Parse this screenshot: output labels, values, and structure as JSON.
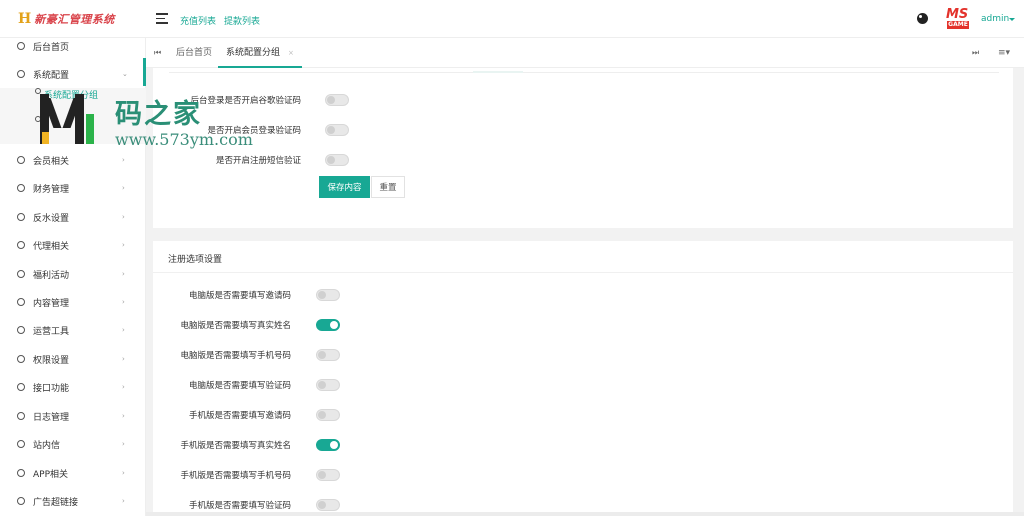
{
  "app": {
    "logo_mark": "H",
    "logo_title": "新豪汇管理系统"
  },
  "header": {
    "links": [
      "充值列表",
      "提款列表"
    ],
    "avatar_text": "MS",
    "avatar_sub": "GAME",
    "user": "admin"
  },
  "sidebar": {
    "items": [
      {
        "label": "后台首页"
      },
      {
        "label": "系统配置"
      },
      {
        "label": "会员相关"
      },
      {
        "label": "财务管理"
      },
      {
        "label": "反水设置"
      },
      {
        "label": "代理相关"
      },
      {
        "label": "福利活动"
      },
      {
        "label": "内容管理"
      },
      {
        "label": "运营工具"
      },
      {
        "label": "权限设置"
      },
      {
        "label": "接口功能"
      },
      {
        "label": "日志管理"
      },
      {
        "label": "站内信"
      },
      {
        "label": "APP相关"
      },
      {
        "label": "广告超链接"
      }
    ],
    "sub_items": [
      "系统配置分组"
    ]
  },
  "tabs": {
    "items": [
      "后台首页",
      "系统配置分组"
    ],
    "close_glyph": "×"
  },
  "panel1": {
    "rows": [
      {
        "label": "后台登录是否开启谷歌验证码",
        "on": false
      },
      {
        "label": "是否开启会员登录验证码",
        "on": false
      },
      {
        "label": "是否开启注册短信验证",
        "on": false
      }
    ],
    "save_label": "保存内容",
    "reset_label": "重置"
  },
  "panel2": {
    "title": "注册选项设置",
    "rows": [
      {
        "label": "电脑版是否需要填写邀请码",
        "on": false
      },
      {
        "label": "电脑版是否需要填写真实姓名",
        "on": true
      },
      {
        "label": "电脑版是否需要填写手机号码",
        "on": false
      },
      {
        "label": "电脑版是否需要填写验证码",
        "on": false
      },
      {
        "label": "手机版是否需要填写邀请码",
        "on": false
      },
      {
        "label": "手机版是否需要填写真实姓名",
        "on": true
      },
      {
        "label": "手机版是否需要填写手机号码",
        "on": false
      },
      {
        "label": "手机版是否需要填写验证码",
        "on": false
      }
    ]
  },
  "watermark": {
    "text": "码之家",
    "url": "www.573ym.com"
  },
  "colors": {
    "accent": "#18a894",
    "logo_red": "#d9434a",
    "logo_gold": "#e3a21a"
  }
}
